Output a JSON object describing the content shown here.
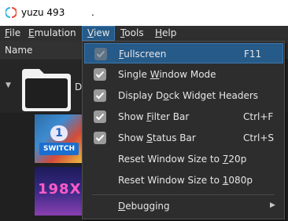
{
  "window": {
    "title": "yuzu 493",
    "title_suffix": "."
  },
  "menubar": {
    "items": [
      {
        "label": "File",
        "mnemonic": "F",
        "rest": "ile"
      },
      {
        "label": "Emulation",
        "mnemonic": "E",
        "rest": "mulation"
      },
      {
        "label": "View",
        "mnemonic": "V",
        "rest": "iew"
      },
      {
        "label": "Tools",
        "mnemonic": "T",
        "rest": "ools"
      },
      {
        "label": "Help",
        "mnemonic": "H",
        "rest": "elp"
      }
    ]
  },
  "gamelist": {
    "column_header": "Name",
    "folder_label": "D:",
    "games": [
      {
        "thumb_text": "SWITCH",
        "thumb_badge": "1"
      },
      {
        "thumb_text": "198X"
      }
    ]
  },
  "view_menu": {
    "items": [
      {
        "pre": "",
        "mn": "F",
        "post": "ullscreen",
        "shortcut": "F11",
        "checked": true
      },
      {
        "pre": "Single ",
        "mn": "W",
        "post": "indow Mode",
        "shortcut": "",
        "checked": true
      },
      {
        "pre": "Display D",
        "mn": "o",
        "post": "ck Widget Headers",
        "shortcut": "",
        "checked": true
      },
      {
        "pre": "Show ",
        "mn": "F",
        "post": "ilter Bar",
        "shortcut": "Ctrl+F",
        "checked": true
      },
      {
        "pre": "Show ",
        "mn": "S",
        "post": "tatus Bar",
        "shortcut": "Ctrl+S",
        "checked": true
      },
      {
        "pre": "Reset Window Size to ",
        "mn": "7",
        "post": "20p",
        "shortcut": "",
        "checked": false
      },
      {
        "pre": "Reset Window Size to ",
        "mn": "1",
        "post": "080p",
        "shortcut": "",
        "checked": false
      },
      {
        "pre": "",
        "mn": "D",
        "post": "ebugging",
        "shortcut": "",
        "checked": false
      }
    ]
  },
  "colors": {
    "highlight": "#265a88",
    "background": "#2b2b2b",
    "menu_bg": "#2d2d2d"
  }
}
